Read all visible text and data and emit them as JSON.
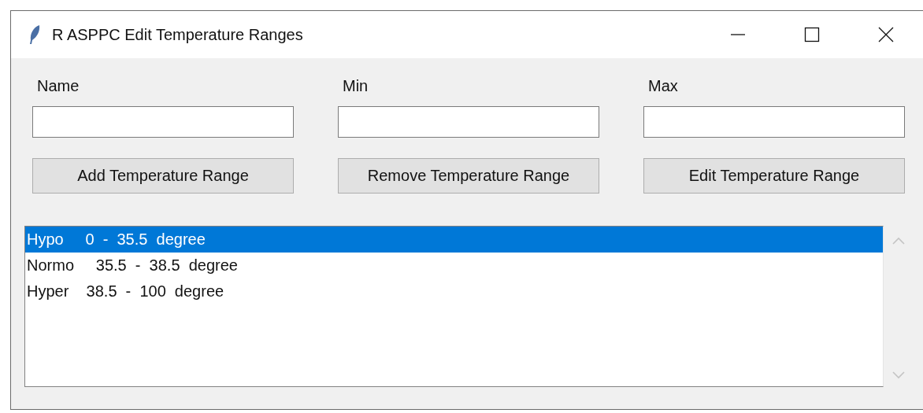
{
  "window": {
    "title": "R ASPPC Edit Temperature Ranges"
  },
  "fields": [
    {
      "label": "Name"
    },
    {
      "label": "Min"
    },
    {
      "label": "Max"
    }
  ],
  "buttons": [
    "Add Temperature Range",
    "Remove Temperature Range",
    "Edit Temperature Range"
  ],
  "list": {
    "items": [
      {
        "text": "Hypo     0  -  35.5  degree",
        "selected": true
      },
      {
        "text": "Normo     35.5  -  38.5  degree",
        "selected": false
      },
      {
        "text": "Hyper    38.5  -  100  degree",
        "selected": false
      }
    ]
  }
}
